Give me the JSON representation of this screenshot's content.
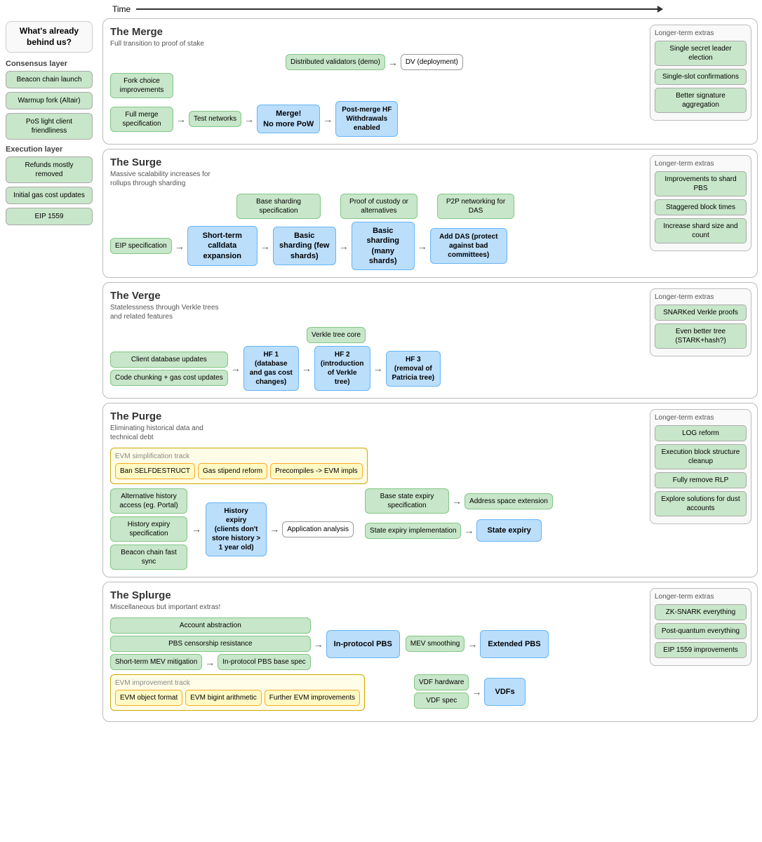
{
  "time_label": "Time",
  "sidebar": {
    "title": "What's already behind us?",
    "consensus_label": "Consensus layer",
    "consensus_items": [
      "Beacon chain launch",
      "Warmup fork (Altair)",
      "PoS light client friendliness"
    ],
    "execution_label": "Execution layer",
    "execution_items": [
      "Refunds mostly removed",
      "Initial gas cost updates",
      "EIP 1559"
    ]
  },
  "sections": {
    "merge": {
      "title": "The Merge",
      "subtitle": "Full transition to proof of stake",
      "extras_title": "Longer-term extras",
      "extras": [
        "Single secret leader election",
        "Single-slot confirmations",
        "Better signature aggregation"
      ],
      "boxes": {
        "fork_choice": "Fork choice improvements",
        "merge_spec": "Full merge specification",
        "test_networks": "Test networks",
        "dist_validators": "Distributed validators (demo)",
        "dv_deploy": "DV (deployment)",
        "merge_now": "Merge!\nNo more PoW",
        "post_merge": "Post-merge HF\nWithdrawals enabled"
      }
    },
    "surge": {
      "title": "The Surge",
      "subtitle": "Massive scalability increases for rollups through sharding",
      "extras_title": "Longer-term extras",
      "extras": [
        "Improvements to shard PBS",
        "Staggered block times",
        "Increase shard size and count"
      ],
      "boxes": {
        "eip_spec": "EIP specification",
        "base_sharding": "Base sharding specification",
        "proof_custody": "Proof of custody or alternatives",
        "p2p_das": "P2P networking for DAS",
        "short_calldata": "Short-term calldata expansion",
        "basic_sharding_few": "Basic sharding (few shards)",
        "basic_sharding_many": "Basic sharding (many shards)",
        "add_das": "Add DAS (protect against bad committees)"
      }
    },
    "verge": {
      "title": "The Verge",
      "subtitle": "Statelessness through Verkle trees and related features",
      "extras_title": "Longer-term extras",
      "extras": [
        "SNARKed Verkle proofs",
        "Even better tree (STARK+hash?)"
      ],
      "boxes": {
        "client_db": "Client database updates",
        "code_chunking": "Code chunking + gas cost updates",
        "verkle_core": "Verkle tree core",
        "hf1": "HF 1\n(database and gas cost changes)",
        "hf2": "HF 2\n(introduction of Verkle tree)",
        "hf3": "HF 3\n(removal of Patricia tree)"
      }
    },
    "purge": {
      "title": "The Purge",
      "subtitle": "Eliminating historical data and technical debt",
      "extras_title": "Longer-term extras",
      "extras": [
        "LOG reform",
        "Execution block structure cleanup",
        "Fully remove RLP",
        "Explore solutions for dust accounts"
      ],
      "evm_track_title": "EVM simplification track",
      "evm_boxes": [
        "Ban SELFDESTRUCT",
        "Gas stipend reform",
        "Precompiles -> EVM impls"
      ],
      "boxes": {
        "alt_history": "Alternative history access (eg. Portal)",
        "history_spec": "History expiry specification",
        "beacon_sync": "Beacon chain fast sync",
        "history_expiry": "History expiry\n(clients don't store history > 1 year old)",
        "app_analysis": "Application analysis",
        "base_state": "Base state expiry specification",
        "address_space": "Address space extension",
        "state_impl": "State expiry implementation",
        "state_expiry": "State expiry"
      }
    },
    "splurge": {
      "title": "The Splurge",
      "subtitle": "Miscellaneous but important extras!",
      "extras_title": "Longer-term extras",
      "extras": [
        "ZK-SNARK everything",
        "Post-quantum everything",
        "EIP 1559 improvements"
      ],
      "evm_track_title": "EVM improvement track",
      "evm_boxes": [
        "EVM object format",
        "EVM bigint arithmetic",
        "Further EVM improvements"
      ],
      "boxes": {
        "account_abstraction": "Account abstraction",
        "pbs_censorship": "PBS censorship resistance",
        "short_mev": "Short-term MEV mitigation",
        "in_protocol_pbs_spec": "In-protocol PBS base spec",
        "in_protocol_pbs": "In-protocol PBS",
        "extended_pbs": "Extended PBS",
        "mev_smoothing": "MEV smoothing",
        "vdf_spec": "VDF spec",
        "vdf_hardware": "VDF hardware",
        "vdfs": "VDFs"
      }
    }
  }
}
